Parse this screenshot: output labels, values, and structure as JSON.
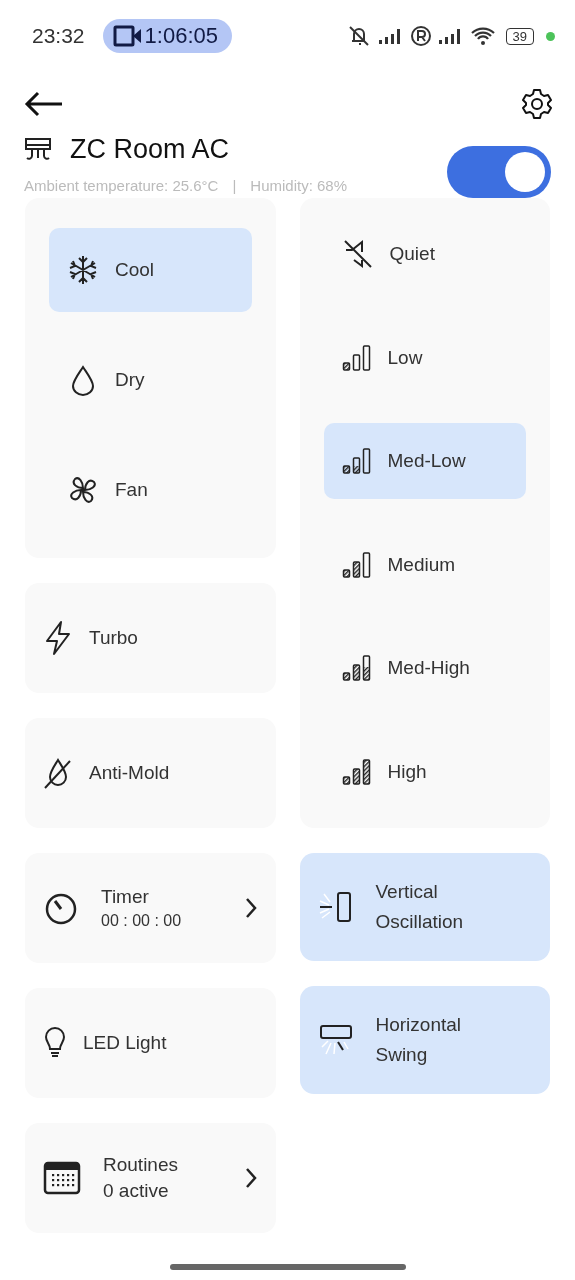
{
  "status_bar": {
    "time": "23:32",
    "recording": "1:06:05",
    "battery": "39"
  },
  "header": {
    "title": "ZC Room AC",
    "power": true,
    "ambient": "Ambient temperature: 25.6°C",
    "separator": "|",
    "humidity": "Humidity: 68%"
  },
  "modes": [
    {
      "label": "Cool",
      "selected": true
    },
    {
      "label": "Dry",
      "selected": false
    },
    {
      "label": "Fan",
      "selected": false
    }
  ],
  "fan_speeds": [
    {
      "label": "Quiet",
      "selected": false
    },
    {
      "label": "Low",
      "selected": false
    },
    {
      "label": "Med-Low",
      "selected": true
    },
    {
      "label": "Medium",
      "selected": false
    },
    {
      "label": "Med-High",
      "selected": false
    },
    {
      "label": "High",
      "selected": false
    }
  ],
  "left_tiles": [
    {
      "kind": "toggle",
      "label": "Turbo",
      "on": false
    },
    {
      "kind": "toggle",
      "label": "Anti-Mold",
      "on": false
    },
    {
      "kind": "link",
      "label": "Timer",
      "detail": "00 : 00 : 00"
    },
    {
      "kind": "toggle",
      "label": "LED Light",
      "on": false
    },
    {
      "kind": "link",
      "label": "Routines",
      "detail": "0 active"
    }
  ],
  "right_tiles": [
    {
      "kind": "toggle",
      "label": "Vertical Oscillation",
      "on": true
    },
    {
      "kind": "toggle",
      "label": "Horizontal Swing",
      "on": true
    }
  ]
}
